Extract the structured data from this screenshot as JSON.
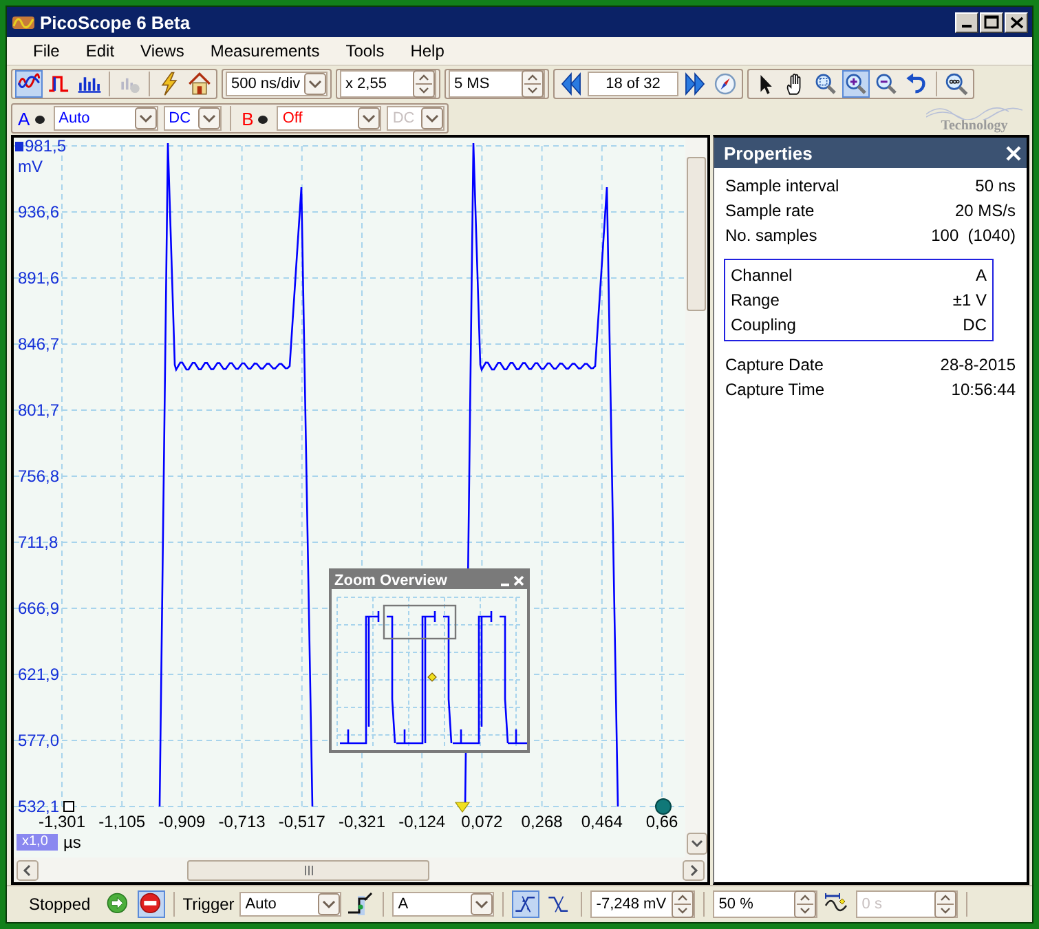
{
  "window": {
    "title": "PicoScope 6 Beta"
  },
  "menu": [
    {
      "label": "File"
    },
    {
      "label": "Edit"
    },
    {
      "label": "Views"
    },
    {
      "label": "Measurements"
    },
    {
      "label": "Tools"
    },
    {
      "label": "Help"
    }
  ],
  "toolbar": {
    "views": [
      {
        "kind": "scope",
        "selected": true
      },
      {
        "kind": "persistence",
        "selected": false
      },
      {
        "kind": "spectrum",
        "selected": false
      }
    ],
    "timebase": "500 ns/div",
    "zoom_factor": "x 2,55",
    "samples": "5 MS",
    "buffer": "18 of 32",
    "tools": [
      {
        "kind": "pointer",
        "selected": false
      },
      {
        "kind": "hand",
        "selected": false
      },
      {
        "kind": "zoom-area",
        "selected": false
      },
      {
        "kind": "zoom-in",
        "selected": true
      },
      {
        "kind": "zoom-out",
        "selected": false
      },
      {
        "kind": "undo",
        "selected": false
      },
      {
        "kind": "zoom-fit",
        "selected": false
      }
    ]
  },
  "logo": {
    "text": "Technology"
  },
  "channels": [
    {
      "name": "A",
      "color": "#0000ff",
      "range": "Auto",
      "coupling": "DC",
      "coupling_disabled": false
    },
    {
      "name": "B",
      "color": "#ff0000",
      "range": "Off",
      "coupling": "DC",
      "coupling_disabled": true
    }
  ],
  "plot": {
    "y_unit": "mV",
    "y_ticks": [
      "981,5",
      "936,6",
      "891,6",
      "846,7",
      "801,7",
      "756,8",
      "711,8",
      "666,9",
      "621,9",
      "577,0",
      "532,1"
    ],
    "x_ticks": [
      "-1,301",
      "-1,105",
      "-0,909",
      "-0,713",
      "-0,517",
      "-0,321",
      "-0,124",
      "0,072",
      "0,268",
      "0,464",
      "0,66"
    ],
    "x_unit": "µs",
    "zoom_badge": "x1,0"
  },
  "zoom_overview": {
    "title": "Zoom Overview"
  },
  "properties": {
    "title": "Properties",
    "groups": [
      {
        "boxed": false,
        "rows": [
          {
            "label": "Sample interval",
            "value": "50 ns"
          },
          {
            "label": "Sample rate",
            "value": "20 MS/s"
          },
          {
            "label": "No. samples",
            "value": "100  (1040)"
          }
        ]
      },
      {
        "boxed": true,
        "rows": [
          {
            "label": "Channel",
            "value": "A"
          },
          {
            "label": "Range",
            "value": "±1 V"
          },
          {
            "label": "Coupling",
            "value": "DC"
          }
        ]
      },
      {
        "boxed": false,
        "rows": [
          {
            "label": "Capture Date",
            "value": "28-8-2015"
          },
          {
            "label": "Capture Time",
            "value": "10:56:44"
          }
        ]
      }
    ]
  },
  "status_bar": {
    "state": "Stopped",
    "buttons": [
      {
        "kind": "run",
        "selected": false
      },
      {
        "kind": "stop",
        "selected": true
      }
    ],
    "trigger_label": "Trigger",
    "trigger_mode": "Auto",
    "trigger_source": "A",
    "edges": [
      {
        "kind": "rising",
        "selected": true
      },
      {
        "kind": "falling",
        "selected": false
      }
    ],
    "threshold": "-7,248 mV",
    "pre_trigger": "50 %",
    "delay": "0 s",
    "delay_disabled": true
  }
}
